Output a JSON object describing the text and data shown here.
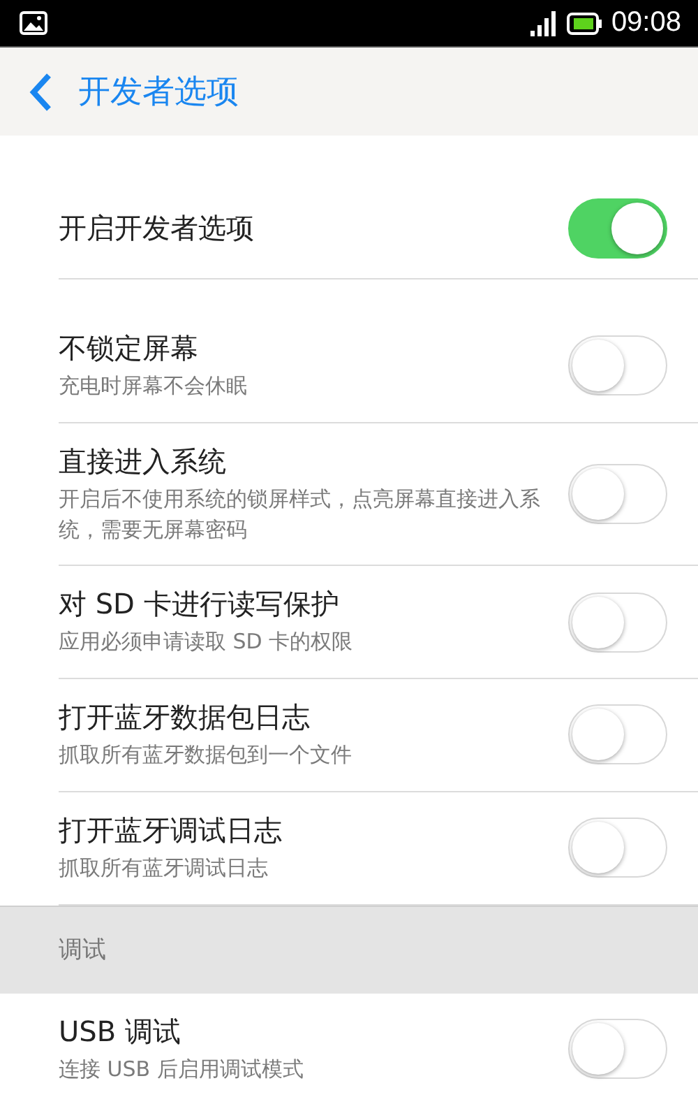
{
  "status_bar": {
    "time": "09:08"
  },
  "header": {
    "title": "开发者选项"
  },
  "master": {
    "label": "开启开发者选项",
    "on": true
  },
  "settings": [
    {
      "title": "不锁定屏幕",
      "subtitle": "充电时屏幕不会休眠",
      "on": false
    },
    {
      "title": "直接进入系统",
      "subtitle": "开启后不使用系统的锁屏样式，点亮屏幕直接进入系统，需要无屏幕密码",
      "on": false
    },
    {
      "title": "对 SD 卡进行读写保护",
      "subtitle": "应用必须申请读取 SD 卡的权限",
      "on": false
    },
    {
      "title": "打开蓝牙数据包日志",
      "subtitle": "抓取所有蓝牙数据包到一个文件",
      "on": false
    },
    {
      "title": "打开蓝牙调试日志",
      "subtitle": "抓取所有蓝牙调试日志",
      "on": false
    }
  ],
  "section": {
    "title": "调试"
  },
  "debug_settings": [
    {
      "title": "USB 调试",
      "subtitle": "连接 USB 后启用调试模式",
      "on": false
    }
  ]
}
